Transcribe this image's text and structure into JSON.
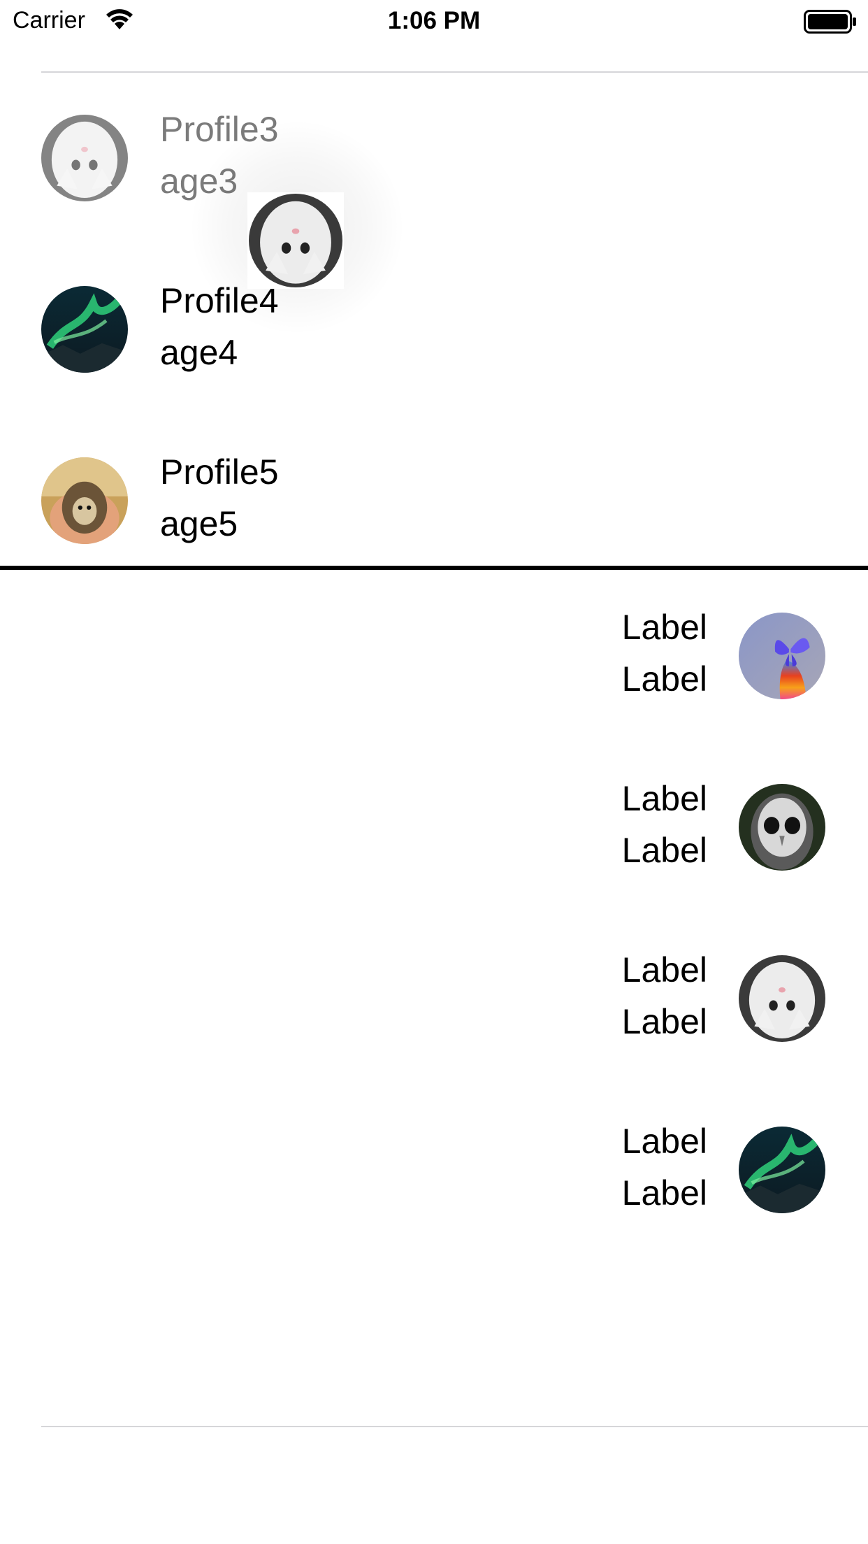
{
  "status_bar": {
    "carrier": "Carrier",
    "time": "1:06 PM",
    "wifi_icon": "wifi-icon",
    "battery_icon": "battery-full-icon"
  },
  "top_list": {
    "rows": [
      {
        "name": "Profile3",
        "age": "age3",
        "avatar_icon": "cat-photo",
        "state": "being-dragged"
      },
      {
        "name": "Profile4",
        "age": "age4",
        "avatar_icon": "aurora-photo"
      },
      {
        "name": "Profile5",
        "age": "age5",
        "avatar_icon": "hedgehog-photo"
      }
    ]
  },
  "drag_preview": {
    "avatar_icon": "cat-photo"
  },
  "bottom_list": {
    "rows": [
      {
        "label1": "Label",
        "label2": "Label",
        "avatar_icon": "butterfly-photo"
      },
      {
        "label1": "Label",
        "label2": "Label",
        "avatar_icon": "owl-photo"
      },
      {
        "label1": "Label",
        "label2": "Label",
        "avatar_icon": "cat-photo"
      },
      {
        "label1": "Label",
        "label2": "Label",
        "avatar_icon": "aurora-photo"
      }
    ]
  },
  "colors": {
    "dimmed_text": "#7b7b7b",
    "separator": "#d6d6d9",
    "thick_separator": "#000000"
  }
}
